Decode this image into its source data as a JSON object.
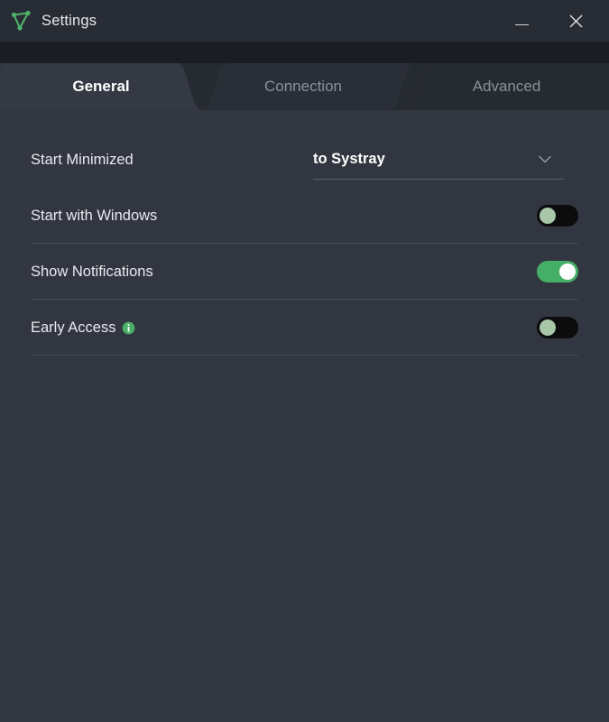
{
  "window": {
    "title": "Settings",
    "logo_icon": "mesh-triangle-logo",
    "minimize_label": "–",
    "close_label": "✕"
  },
  "tabs": [
    {
      "id": "general",
      "label": "General",
      "active": true
    },
    {
      "id": "connection",
      "label": "Connection",
      "active": false
    },
    {
      "id": "advanced",
      "label": "Advanced",
      "active": false
    }
  ],
  "settings": [
    {
      "id": "start-minimized",
      "label": "Start Minimized",
      "control": "dropdown",
      "value": "to Systray",
      "chevron_icon": "chevron-down-icon"
    },
    {
      "id": "start-with-windows",
      "label": "Start with Windows",
      "control": "toggle",
      "state": "off"
    },
    {
      "id": "show-notifications",
      "label": "Show Notifications",
      "control": "toggle",
      "state": "on"
    },
    {
      "id": "early-access",
      "label": "Early Access",
      "control": "toggle",
      "state": "off",
      "info_icon": "info-icon",
      "has_info": true
    }
  ],
  "colors": {
    "titlebar_bg": "#282c34",
    "strip_bg": "#1c1d22",
    "content_bg": "#323641",
    "tab_active_bg": "#353944",
    "tab_inactive_bg": "#262a31",
    "accent_green": "#46af67",
    "logo_green": "#4fb36b",
    "toggle_off_track": "#0c0c0d",
    "toggle_off_knob": "#a9c6a9",
    "divider": "#474b57",
    "text_primary": "#e9eaee",
    "text_muted": "#8b909b"
  }
}
